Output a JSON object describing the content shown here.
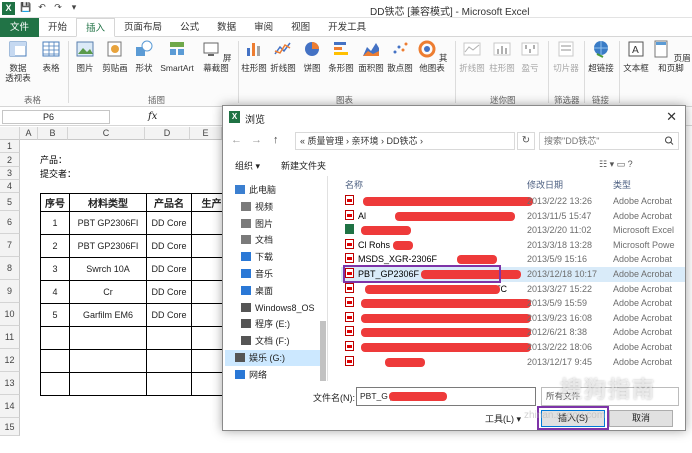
{
  "excel": {
    "logo": "X",
    "window_title": "DD铁芯  [兼容模式] - Microsoft Excel",
    "qat": [
      "💾",
      "↶",
      "↷",
      "▾"
    ],
    "tabs": [
      "文件",
      "开始",
      "插入",
      "页面布局",
      "公式",
      "数据",
      "审阅",
      "视图",
      "开发工具"
    ],
    "ribbon_buttons": [
      {
        "label": "数据\n透视表",
        "icon": "pivot-table-icon"
      },
      {
        "label": "表格",
        "icon": "table-icon"
      },
      {
        "label": "图片",
        "icon": "picture-icon"
      },
      {
        "label": "剪贴画",
        "icon": "clipart-icon"
      },
      {
        "label": "形状",
        "icon": "shapes-icon"
      },
      {
        "label": "SmartArt",
        "icon": "smartart-icon"
      },
      {
        "label": "屏幕截图",
        "icon": "screenshot-icon"
      },
      {
        "label": "柱形图",
        "icon": "column-chart-icon"
      },
      {
        "label": "折线图",
        "icon": "line-chart-icon"
      },
      {
        "label": "饼图",
        "icon": "pie-chart-icon"
      },
      {
        "label": "条形图",
        "icon": "bar-chart-icon"
      },
      {
        "label": "面积图",
        "icon": "area-chart-icon"
      },
      {
        "label": "散点图",
        "icon": "scatter-chart-icon"
      },
      {
        "label": "其他图表",
        "icon": "other-charts-icon"
      },
      {
        "label": "折线图",
        "icon": "sparkline-line-icon"
      },
      {
        "label": "柱形图",
        "icon": "sparkline-column-icon"
      },
      {
        "label": "盈亏",
        "icon": "sparkline-winloss-icon"
      },
      {
        "label": "切片器",
        "icon": "slicer-icon"
      },
      {
        "label": "超链接",
        "icon": "hyperlink-icon"
      },
      {
        "label": "文本框",
        "icon": "textbox-icon"
      },
      {
        "label": "页眉和页脚",
        "icon": "header-footer-icon"
      }
    ],
    "groups": [
      "表格",
      "插图",
      "图表",
      "迷你图",
      "筛选器",
      "链接"
    ],
    "name_box": "P6",
    "fx": "fx",
    "columns": [
      "A",
      "B",
      "C",
      "D",
      "E"
    ],
    "rows": [
      "1",
      "2",
      "3",
      "4",
      "5",
      "6",
      "7",
      "8",
      "9",
      "10",
      "11",
      "12",
      "13",
      "14",
      "15"
    ],
    "product_label": "产品：",
    "submitter_label": "提交者：",
    "table": {
      "headers": [
        "序号",
        "材料类型",
        "产品名",
        "生产"
      ],
      "rows": [
        [
          "1",
          "PBT GP2306FI",
          "DD Core",
          ""
        ],
        [
          "2",
          "PBT GP2306FI",
          "DD Core",
          ""
        ],
        [
          "3",
          "Swrch 10A",
          "DD Core",
          ""
        ],
        [
          "4",
          "Cr",
          "DD Core",
          ""
        ],
        [
          "5",
          "Garfilm EM6",
          "DD Core",
          ""
        ],
        [
          "",
          "",
          "",
          ""
        ],
        [
          "",
          "",
          "",
          ""
        ],
        [
          "",
          "",
          "",
          ""
        ]
      ]
    }
  },
  "dialog": {
    "title": "浏览",
    "close": "✕",
    "back": "←",
    "forward": "→",
    "up": "↑",
    "address": "«  质量管理  ›  亲环境  ›  DD铁芯  ›",
    "refresh": "↻",
    "search_placeholder": "搜索\"DD铁芯\"",
    "organize": "组织 ▾",
    "new_folder": "新建文件夹",
    "view_icons": "☷ ▾   ▭   ?",
    "nav": [
      {
        "label": "此电脑",
        "icon": "computer-icon",
        "indent": false
      },
      {
        "label": "视频",
        "icon": "video-folder-icon",
        "indent": true
      },
      {
        "label": "图片",
        "icon": "pictures-folder-icon",
        "indent": true
      },
      {
        "label": "文档",
        "icon": "documents-folder-icon",
        "indent": true
      },
      {
        "label": "下载",
        "icon": "downloads-folder-icon",
        "indent": true
      },
      {
        "label": "音乐",
        "icon": "music-folder-icon",
        "indent": true
      },
      {
        "label": "桌面",
        "icon": "desktop-folder-icon",
        "indent": true
      },
      {
        "label": "Windows8_OS",
        "icon": "drive-icon",
        "indent": true
      },
      {
        "label": "程序 (E:)",
        "icon": "drive-icon",
        "indent": true
      },
      {
        "label": "文档 (F:)",
        "icon": "drive-icon",
        "indent": true
      },
      {
        "label": "娱乐 (G:)",
        "icon": "drive-icon",
        "indent": true
      },
      {
        "label": "网络",
        "icon": "network-icon",
        "indent": false
      }
    ],
    "columns": {
      "name": "名称",
      "date": "修改日期",
      "type": "类型"
    },
    "files": [
      {
        "name": "",
        "date": "2013/2/22 13:26",
        "type": "Adobe Acrobat",
        "icon": "pdf"
      },
      {
        "name": "Al",
        "name_tail": "RoH",
        "date": "2013/11/5 15:47",
        "type": "Adobe Acrobat",
        "icon": "pdf"
      },
      {
        "name": "",
        "date": "2013/2/20 11:02",
        "type": "Microsoft Excel",
        "icon": "xlsx"
      },
      {
        "name": "Cl    Rohs",
        "date": "2013/3/18 13:28",
        "type": "Microsoft Powe",
        "icon": "pdf"
      },
      {
        "name": "MSDS_XGR-2306F",
        "date": "2013/5/9 15:16",
        "type": "Adobe Acrobat",
        "icon": "pdf"
      },
      {
        "name": "PBT_GP2306F",
        "name_tail": "(2)",
        "date": "2013/12/18 10:17",
        "type": "Adobe Acrobat",
        "icon": "pdf"
      },
      {
        "name": "",
        "name_tail": "TC",
        "date": "2013/3/27 15:22",
        "type": "Adobe Acrobat",
        "icon": "pdf"
      },
      {
        "name": "",
        "date": "2013/5/9 15:59",
        "type": "Adobe Acrobat",
        "icon": "pdf"
      },
      {
        "name": "",
        "date": "2013/9/23 16:08",
        "type": "Adobe Acrobat",
        "icon": "pdf"
      },
      {
        "name": "",
        "date": "2012/6/21 8:38",
        "type": "Adobe Acrobat",
        "icon": "pdf"
      },
      {
        "name": "",
        "date": "2013/2/22 18:06",
        "type": "Adobe Acrobat",
        "icon": "pdf"
      },
      {
        "name": "",
        "date": "2013/12/17 9:45",
        "type": "Adobe Acrobat",
        "icon": "pdf"
      }
    ],
    "filename_label": "文件名(N):",
    "filename_value": "PBT_G                  _20131113_(2)",
    "filetype": "所有文件",
    "tools": "工具(L)  ▾",
    "insert_button": "插入(S)",
    "cancel_button": "取消"
  },
  "watermark": "搜狗指南",
  "watermark_url": "zhinan.sogou.com",
  "colors": {
    "excel_green": "#217346",
    "selection": "#d9ebf9",
    "highlight": "#7d33a8",
    "redaction": "#ee3a3a"
  }
}
